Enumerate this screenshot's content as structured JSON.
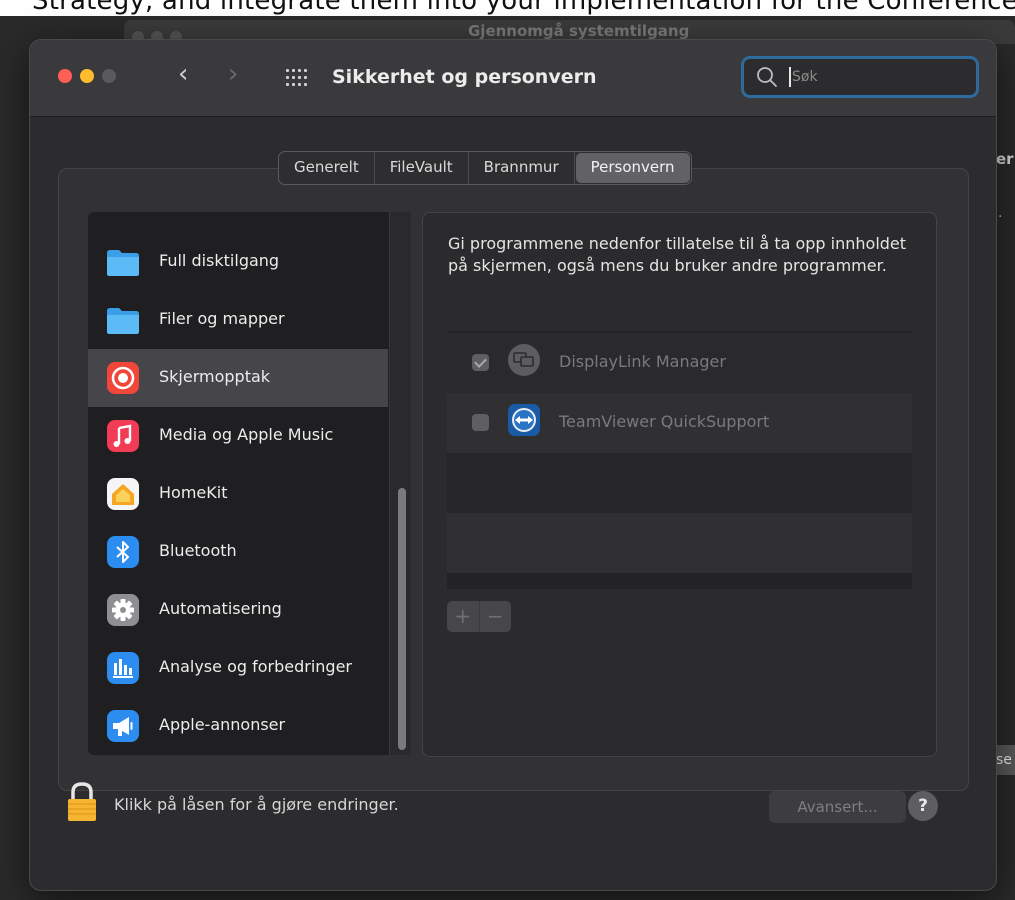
{
  "background": {
    "cropped_top_text": "Strategy, and integrate them into your implementation for the Conference Facility, and",
    "behind_window_title": "Gjennomgå systemtilgang",
    "behind_side_text_1": "er",
    "behind_side_text_2": ".",
    "behind_side_button": "se"
  },
  "window": {
    "title": "Sikkerhet og personvern",
    "nav_back": "‹",
    "nav_forward": "›",
    "search": {
      "value": "",
      "placeholder": "Søk"
    }
  },
  "tabs": [
    {
      "label": "Generelt",
      "active": false
    },
    {
      "label": "FileVault",
      "active": false
    },
    {
      "label": "Brannmur",
      "active": false
    },
    {
      "label": "Personvern",
      "active": true
    }
  ],
  "sidebar": {
    "items": [
      {
        "label": "Full disktilgang",
        "icon": "folder-icon"
      },
      {
        "label": "Filer og mapper",
        "icon": "folder-icon"
      },
      {
        "label": "Skjermopptak",
        "icon": "screen-recording-icon",
        "selected": true
      },
      {
        "label": "Media og Apple Music",
        "icon": "music-icon"
      },
      {
        "label": "HomeKit",
        "icon": "home-icon"
      },
      {
        "label": "Bluetooth",
        "icon": "bluetooth-icon"
      },
      {
        "label": "Automatisering",
        "icon": "gear-icon"
      },
      {
        "label": "Analyse og forbedringer",
        "icon": "analytics-icon"
      },
      {
        "label": "Apple-annonser",
        "icon": "megaphone-icon"
      }
    ]
  },
  "content": {
    "description": "Gi programmene nedenfor tillatelse til å ta opp innholdet på skjermen, også mens du bruker andre programmer.",
    "apps": [
      {
        "name": "DisplayLink Manager",
        "checked": true
      },
      {
        "name": "TeamViewer QuickSupport",
        "checked": false
      }
    ],
    "add_label": "+",
    "remove_label": "−"
  },
  "footer": {
    "lock_text": "Klikk på låsen for å gjøre endringer.",
    "advanced_label": "Avansert...",
    "help_label": "?"
  },
  "colors": {
    "accent": "#2f6a9c",
    "close": "#fe5f57",
    "minimize": "#febc2e",
    "window_bg": "#2c2c2e",
    "selected_row": "#46464a"
  }
}
